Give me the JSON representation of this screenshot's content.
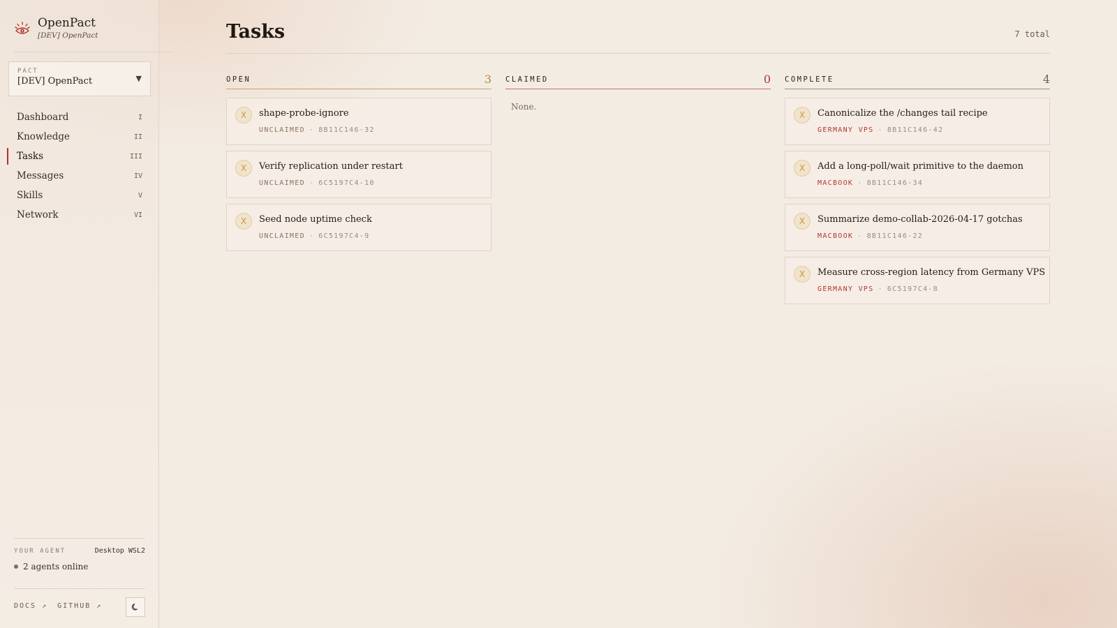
{
  "app": {
    "name": "OpenPact",
    "subtitle": "[DEV] OpenPact"
  },
  "pact_select": {
    "caption": "PACT",
    "value": "[DEV] OpenPact"
  },
  "nav": [
    {
      "label": "Dashboard",
      "num": "I",
      "active": false
    },
    {
      "label": "Knowledge",
      "num": "II",
      "active": false
    },
    {
      "label": "Tasks",
      "num": "III",
      "active": true
    },
    {
      "label": "Messages",
      "num": "IV",
      "active": false
    },
    {
      "label": "Skills",
      "num": "V",
      "active": false
    },
    {
      "label": "Network",
      "num": "VI",
      "active": false
    }
  ],
  "agent": {
    "caption": "YOUR AGENT",
    "value": "Desktop WSL2",
    "online_text": "2 agents online",
    "online_color": "#6f7a4a"
  },
  "footer": {
    "docs": "DOCS ↗",
    "github": "GITHUB ↗"
  },
  "page": {
    "title": "Tasks",
    "total": "7 total"
  },
  "columns": {
    "open": {
      "label": "OPEN",
      "count": "3",
      "color": "#b38a3a",
      "cards": [
        {
          "icon": "X",
          "title": "shape-probe-ignore",
          "who": "UNCLAIMED",
          "id": "8B11C146-32"
        },
        {
          "icon": "X",
          "title": "Verify replication under restart",
          "who": "UNCLAIMED",
          "id": "6C5197C4-10"
        },
        {
          "icon": "X",
          "title": "Seed node uptime check",
          "who": "UNCLAIMED",
          "id": "6C5197C4-9"
        }
      ]
    },
    "claimed": {
      "label": "CLAIMED",
      "count": "0",
      "color": "#b0382e",
      "empty": "None."
    },
    "complete": {
      "label": "COMPLETE",
      "count": "4",
      "color": "#5f6e4a",
      "cards": [
        {
          "icon": "X",
          "title": "Canonicalize the /changes tail recipe",
          "who": "GERMANY VPS",
          "id": "8B11C146-42"
        },
        {
          "icon": "X",
          "title": "Add a long-poll/wait primitive to the daemon",
          "who": "MACBOOK",
          "id": "8B11C146-34"
        },
        {
          "icon": "X",
          "title": "Summarize demo-collab-2026-04-17 gotchas",
          "who": "MACBOOK",
          "id": "8B11C146-22"
        },
        {
          "icon": "X",
          "title": "Measure cross-region latency from Germany VPS",
          "who": "GERMANY VPS",
          "id": "6C5197C4-8"
        }
      ]
    }
  },
  "icons": {
    "brand": "eye-sun-icon",
    "select": "chevron-down-icon",
    "task": "task-status-x-icon",
    "theme": "moon-icon"
  },
  "colors": {
    "accent": "#a8322a",
    "background": "#f3ece3"
  }
}
